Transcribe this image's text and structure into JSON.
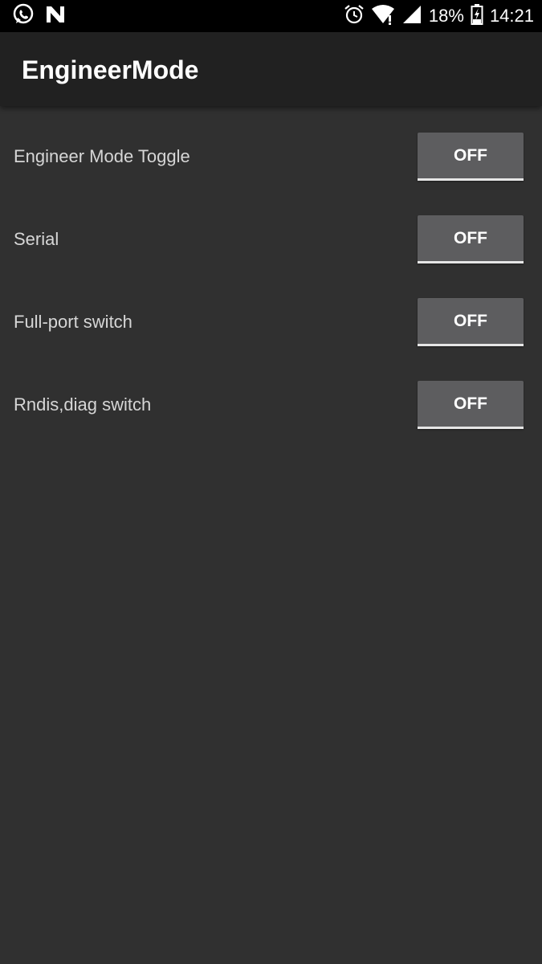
{
  "status_bar": {
    "left_icons": [
      "whatsapp-icon",
      "n-notification-icon"
    ],
    "right_icons": [
      "alarm-icon",
      "wifi-icon",
      "signal-icon",
      "battery-icon"
    ],
    "battery_percent": "18%",
    "time": "14:21"
  },
  "app_bar": {
    "title": "EngineerMode"
  },
  "settings": [
    {
      "label": "Engineer Mode Toggle",
      "state": "OFF"
    },
    {
      "label": "Serial",
      "state": "OFF"
    },
    {
      "label": "Full-port switch",
      "state": "OFF"
    },
    {
      "label": "Rndis,diag switch",
      "state": "OFF"
    }
  ],
  "colors": {
    "background": "#303030",
    "app_bar": "#212121",
    "status_bar": "#000000",
    "button": "#5d5d5f",
    "label_text": "#d6d6d6"
  }
}
